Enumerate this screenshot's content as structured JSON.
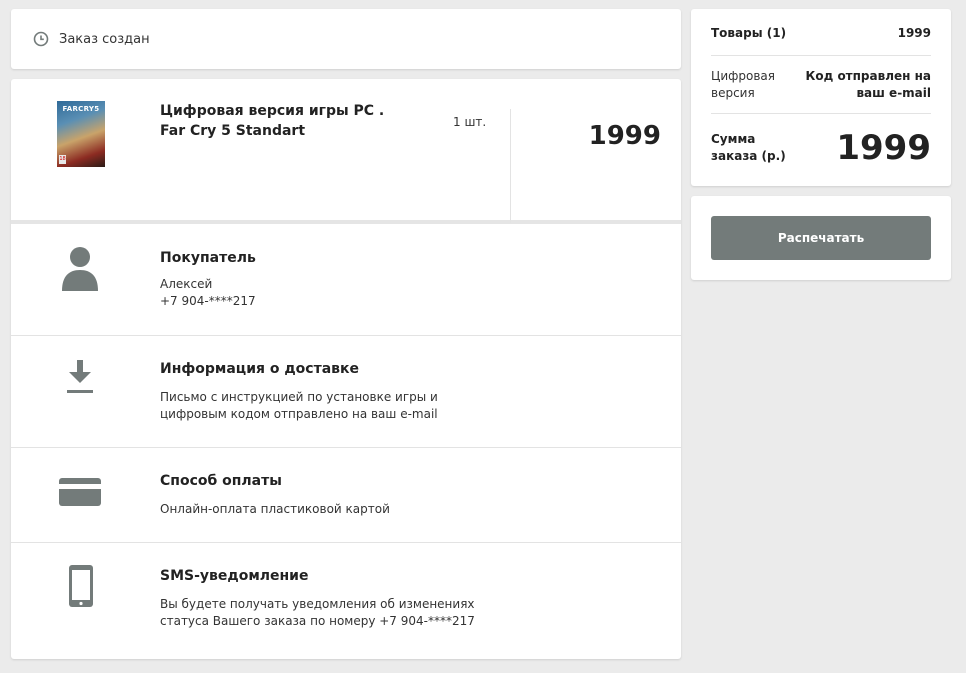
{
  "status": {
    "icon": "clock-icon",
    "text": "Заказ создан"
  },
  "product": {
    "image_icon": "game-cover-image",
    "image_logo_text": "FARCRY5",
    "title": "Цифровая версия игры PC . Far Cry 5 Standart",
    "quantity": "1 шт.",
    "price": "1999"
  },
  "buyer": {
    "icon": "person-icon",
    "title": "Покупатель",
    "name": "Алексей",
    "phone": "+7 904-****217"
  },
  "delivery": {
    "icon": "download-icon",
    "title": "Информация о доставке",
    "text": "Письмо с инструкцией по установке игры и цифровым кодом отправлено на ваш e-mail"
  },
  "payment": {
    "icon": "credit-card-icon",
    "title": "Способ оплаты",
    "text": "Онлайн-оплата пластиковой картой"
  },
  "sms": {
    "icon": "mobile-phone-icon",
    "title": "SMS-уведомление",
    "text": "Вы будете получать уведомления об изменениях статуса Вашего заказа по номеру  +7 904-****217"
  },
  "summary": {
    "goods_label": "Товары (1)",
    "goods_value": "1999",
    "digital_label": "Цифровая версия",
    "digital_value": "Код отправлен на ваш e-mail",
    "total_label": "Сумма заказа (р.)",
    "total_value": "1999"
  },
  "print": {
    "label": "Распечатать",
    "color": "#737b7a"
  },
  "colors": {
    "icon": "#737b7a",
    "background": "#ebebeb",
    "card": "#ffffff"
  }
}
